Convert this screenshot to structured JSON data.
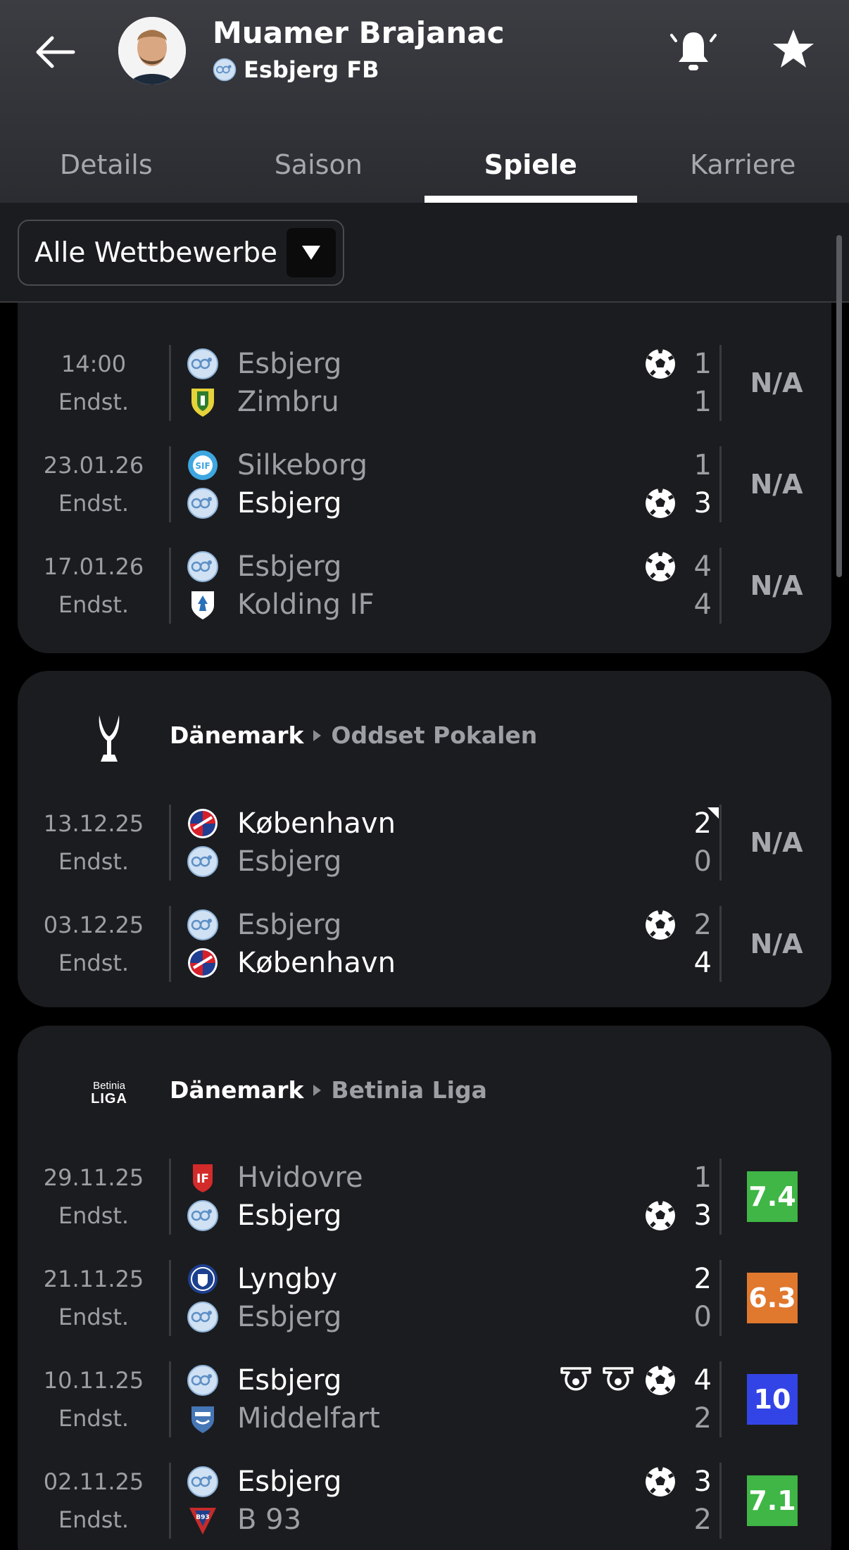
{
  "header": {
    "player_name": "Muamer Brajanac",
    "club_name": "Esbjerg FB"
  },
  "tabs": [
    {
      "label": "Details",
      "active": false
    },
    {
      "label": "Saison",
      "active": false
    },
    {
      "label": "Spiele",
      "active": true
    },
    {
      "label": "Karriere",
      "active": false
    }
  ],
  "filter": {
    "label": "Alle Wettbewerbe"
  },
  "colors": {
    "rating_green": "#3fb645",
    "rating_orange": "#e0782e",
    "rating_blue": "#3344e6",
    "card_bg": "#1b1c1f"
  },
  "sections": [
    {
      "matches": [
        {
          "date": "14:00",
          "status": "Endst.",
          "home": "Esbjerg",
          "away": "Zimbru",
          "home_score": "1",
          "away_score": "1",
          "rating": "N/A"
        },
        {
          "date": "23.01.26",
          "status": "Endst.",
          "home": "Silkeborg",
          "away": "Esbjerg",
          "home_score": "1",
          "away_score": "3",
          "rating": "N/A"
        },
        {
          "date": "17.01.26",
          "status": "Endst.",
          "home": "Esbjerg",
          "away": "Kolding IF",
          "home_score": "4",
          "away_score": "4",
          "rating": "N/A"
        }
      ]
    },
    {
      "country": "Dänemark",
      "competition": "Oddset Pokalen",
      "matches": [
        {
          "date": "13.12.25",
          "status": "Endst.",
          "home": "København",
          "away": "Esbjerg",
          "home_score": "2",
          "away_score": "0",
          "rating": "N/A"
        },
        {
          "date": "03.12.25",
          "status": "Endst.",
          "home": "Esbjerg",
          "away": "København",
          "home_score": "2",
          "away_score": "4",
          "rating": "N/A"
        }
      ]
    },
    {
      "country": "Dänemark",
      "competition": "Betinia Liga",
      "logo_text_top": "Betinia",
      "logo_text_bottom": "LIGA",
      "matches": [
        {
          "date": "29.11.25",
          "status": "Endst.",
          "home": "Hvidovre",
          "away": "Esbjerg",
          "home_score": "1",
          "away_score": "3",
          "rating": "7.4"
        },
        {
          "date": "21.11.25",
          "status": "Endst.",
          "home": "Lyngby",
          "away": "Esbjerg",
          "home_score": "2",
          "away_score": "0",
          "rating": "6.3"
        },
        {
          "date": "10.11.25",
          "status": "Endst.",
          "home": "Esbjerg",
          "away": "Middelfart",
          "home_score": "4",
          "away_score": "2",
          "rating": "10"
        },
        {
          "date": "02.11.25",
          "status": "Endst.",
          "home": "Esbjerg",
          "away": "B 93",
          "home_score": "3",
          "away_score": "2",
          "rating": "7.1"
        }
      ]
    }
  ]
}
